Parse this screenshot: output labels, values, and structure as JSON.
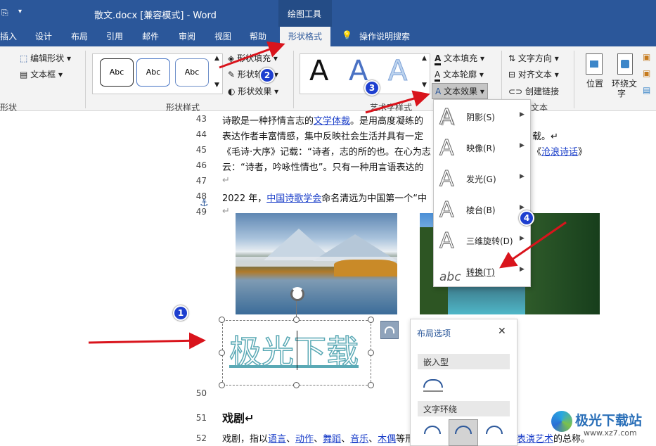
{
  "window": {
    "title": "散文.docx [兼容模式]  -  Word",
    "context_tab_group": "绘图工具"
  },
  "tabs": [
    {
      "label": "插入"
    },
    {
      "label": "设计"
    },
    {
      "label": "布局"
    },
    {
      "label": "引用"
    },
    {
      "label": "邮件"
    },
    {
      "label": "审阅"
    },
    {
      "label": "视图"
    },
    {
      "label": "帮助"
    },
    {
      "label": "形状格式"
    },
    {
      "label": "操作说明搜索"
    }
  ],
  "ribbon": {
    "insert_shapes": {
      "edit_shape": "编辑形状",
      "textbox": "文本框",
      "group_label": "形状"
    },
    "shape_styles": {
      "preview_text": "Abc",
      "shape_fill": "形状填充",
      "shape_outline": "形状轮廓",
      "shape_effects": "形状效果",
      "group_label": "形状样式"
    },
    "wordart": {
      "letter": "A",
      "text_fill": "文本填充",
      "text_outline": "文本轮廓",
      "text_effects": "文本效果",
      "group_label": "艺术字样式"
    },
    "text": {
      "text_direction": "文字方向",
      "align_text": "对齐文本",
      "create_link": "创建链接",
      "group_label": "文本"
    },
    "arrange": {
      "position": "位置",
      "wrap_text_1": "环绕文",
      "wrap_text_2": "字"
    }
  },
  "document": {
    "lines": [
      {
        "num": "43",
        "text": "诗歌是一种抒情言志的文学体裁。是用高度凝练的"
      },
      {
        "num": "44",
        "text": "表达作者丰富情感，集中反映社会生活并具有一定",
        "tail": "载。↵"
      },
      {
        "num": "45",
        "text": "《毛诗·大序》记载：“诗者，志的所的也。在心为志",
        "tail": "《沧浪诗话》"
      },
      {
        "num": "46",
        "text": "云：“诗者，吟咏性情也”。只有一种用言语表达的"
      },
      {
        "num": "47",
        "text": "↵"
      },
      {
        "num": "48",
        "text": "2022 年，中国诗歌学会命名清远为中国第一个“中"
      },
      {
        "num": "49",
        "text": "↵"
      },
      {
        "num": "50",
        "text": ""
      },
      {
        "num": "51",
        "text": "戏剧↵"
      },
      {
        "num": "52",
        "text": "戏剧，指以语言、动作、舞蹈、音乐、木偶等形",
        "tail": "表演艺术的总称。"
      }
    ],
    "links": [
      "文学体裁",
      "中国诗歌学会",
      "沧浪诗话",
      "语言",
      "动作",
      "舞蹈",
      "音乐",
      "木偶",
      "表演艺术"
    ],
    "wordart_text": "极光下载"
  },
  "text_effects_menu": [
    {
      "label": "阴影(S)",
      "icon": "shadow-a-icon"
    },
    {
      "label": "映像(R)",
      "icon": "reflection-a-icon"
    },
    {
      "label": "发光(G)",
      "icon": "glow-a-icon"
    },
    {
      "label": "棱台(B)",
      "icon": "bevel-a-icon"
    },
    {
      "label": "三维旋转(D)",
      "icon": "3d-rotation-a-icon"
    },
    {
      "label": "转换(T)",
      "icon": "transform-abc-icon"
    }
  ],
  "layout_options": {
    "title": "布局选项",
    "close": "✕",
    "inline": "嵌入型",
    "wrap": "文字环绕"
  },
  "badges": [
    "1",
    "2",
    "3",
    "4"
  ],
  "watermark": {
    "text": "极光下载站",
    "url": "www.xz7.com"
  },
  "colors": {
    "word_blue": "#2b579a",
    "badge_blue": "#1e3fcf",
    "arrow_red": "#d9141c",
    "wordart_teal": "#5aa9b5",
    "link_blue": "#1a3ec9"
  }
}
